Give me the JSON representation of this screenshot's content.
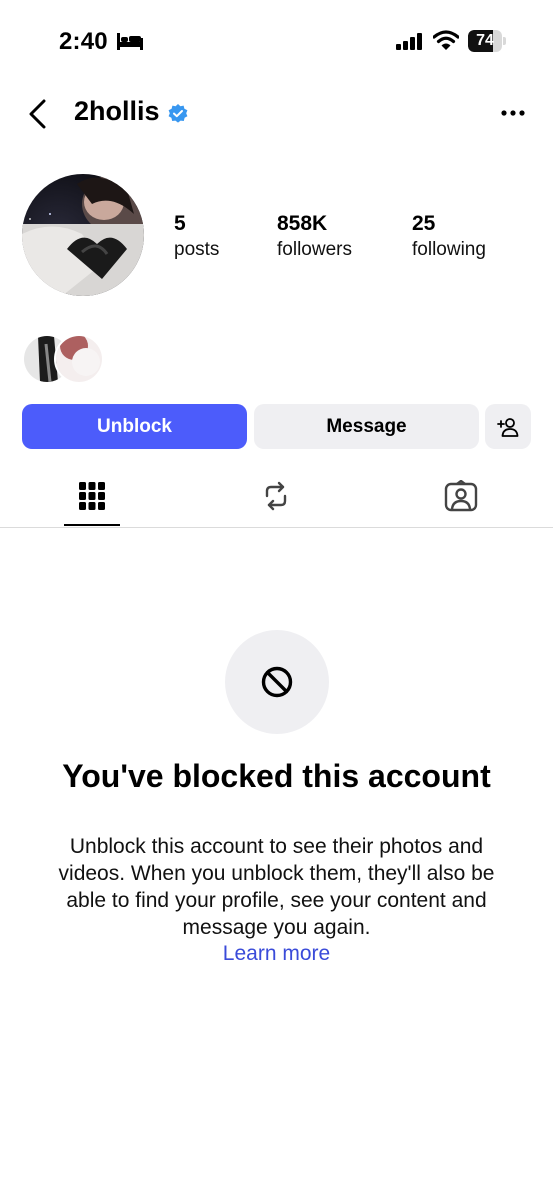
{
  "status_bar": {
    "time": "2:40",
    "battery_level": 74,
    "battery_text": "74",
    "icons": [
      "bed-icon",
      "signal-icon",
      "wifi-icon",
      "battery-icon"
    ]
  },
  "header": {
    "username": "2hollis",
    "verified": true,
    "icons": [
      "back-arrow-icon",
      "verified-badge-icon",
      "more-options-icon"
    ]
  },
  "profile": {
    "stats": {
      "posts": {
        "value": "5",
        "label": "posts"
      },
      "followers": {
        "value": "858K",
        "label": "followers"
      },
      "following": {
        "value": "25",
        "label": "following"
      }
    }
  },
  "actions": {
    "unblock_label": "Unblock",
    "message_label": "Message",
    "add_icon": "add-person-icon"
  },
  "tabs": [
    {
      "icon": "grid-icon",
      "active": true
    },
    {
      "icon": "reposts-icon",
      "active": false
    },
    {
      "icon": "tagged-icon",
      "active": false
    }
  ],
  "blocked": {
    "icon": "blocked-icon",
    "title": "You've blocked this account",
    "description": "Unblock this account to see their photos and videos. When you unblock them, they'll also be able to find your profile, see your content and message you again.",
    "learn_more": "Learn more"
  },
  "colors": {
    "accent_blue": "#4c5cfb",
    "verified_blue": "#3897f0",
    "link_blue": "#3a4bd9",
    "button_gray": "#efeff2"
  }
}
